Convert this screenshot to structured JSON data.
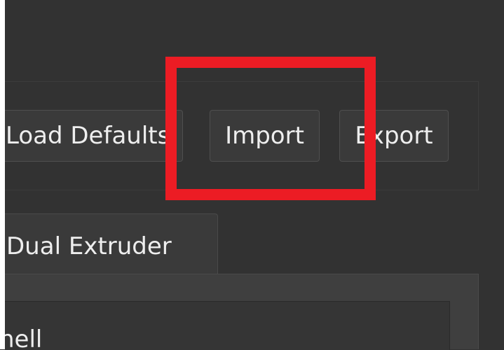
{
  "toolbar": {
    "load_defaults_label": "Load Defaults",
    "import_label": "Import",
    "export_label": "Export"
  },
  "tabs": [
    {
      "label": "Dual Extruder"
    }
  ],
  "panel": {
    "visible_text": "hell"
  },
  "colors": {
    "background": "#323232",
    "button": "#3a3a3a",
    "highlight": "#ec1c24",
    "text": "#eeeeee"
  }
}
